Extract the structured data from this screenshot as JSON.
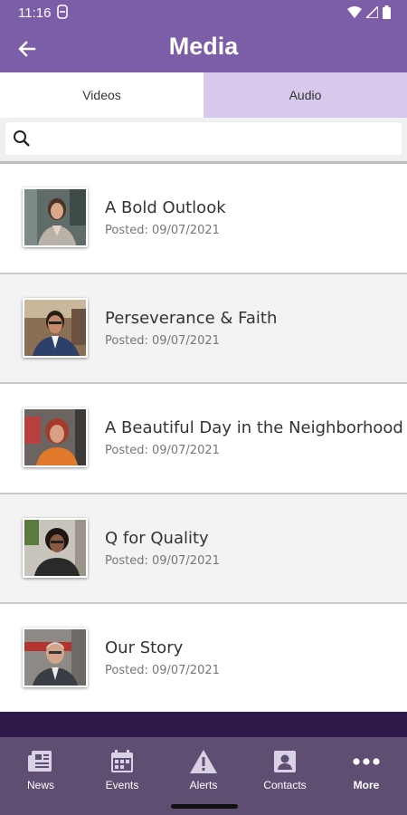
{
  "status_bar": {
    "time": "11:16"
  },
  "app_bar": {
    "title": "Media",
    "back_label": "Back"
  },
  "tabs": [
    {
      "label": "Videos",
      "active": true
    },
    {
      "label": "Audio",
      "active": false
    }
  ],
  "search": {
    "placeholder": "",
    "value": ""
  },
  "media_items": [
    {
      "title": "A Bold Outlook",
      "date": "Posted: 09/07/2021"
    },
    {
      "title": "Perseverance & Faith",
      "date": "Posted: 09/07/2021"
    },
    {
      "title": "A Beautiful Day in the Neighborhood",
      "date": "Posted: 09/07/2021"
    },
    {
      "title": "Q for Quality",
      "date": "Posted: 09/07/2021"
    },
    {
      "title": "Our Story",
      "date": "Posted: 09/07/2021"
    }
  ],
  "bottom_nav": [
    {
      "label": "News",
      "icon": "newspaper-icon"
    },
    {
      "label": "Events",
      "icon": "calendar-icon"
    },
    {
      "label": "Alerts",
      "icon": "alert-icon"
    },
    {
      "label": "Contacts",
      "icon": "contact-icon"
    },
    {
      "label": "More",
      "icon": "more-icon",
      "active": true
    }
  ],
  "colors": {
    "primary": "#7b5ea7",
    "tab_inactive": "#d6c9ec",
    "nav_bg": "#5e4f72",
    "band": "#2d1a4a"
  }
}
